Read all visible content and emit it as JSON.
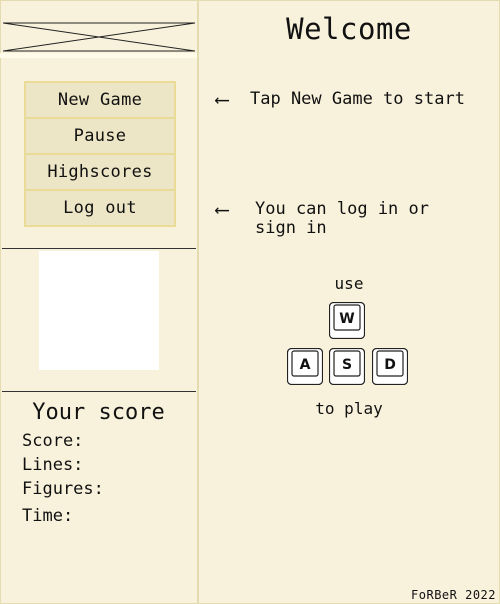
{
  "title": "Welcome",
  "menu": {
    "items": [
      "New Game",
      "Pause",
      "Highscores",
      "Log out"
    ]
  },
  "score": {
    "title": "Your score",
    "labels": {
      "score": "Score:",
      "lines": "Lines:",
      "figures": "Figures:",
      "time": "Time:"
    }
  },
  "hints": {
    "new_game": "Tap New Game to start",
    "login_line1": "You can log in or",
    "login_line2": "sign in"
  },
  "controls": {
    "use": "use",
    "keys": {
      "w": "W",
      "a": "A",
      "s": "S",
      "d": "D"
    },
    "to_play": "to play"
  },
  "footer": {
    "credit": "FoRBeR 2022"
  },
  "colors": {
    "background": "#f8f2dc",
    "menu_bg": "#ece6c6",
    "menu_border": "#eadb97"
  }
}
